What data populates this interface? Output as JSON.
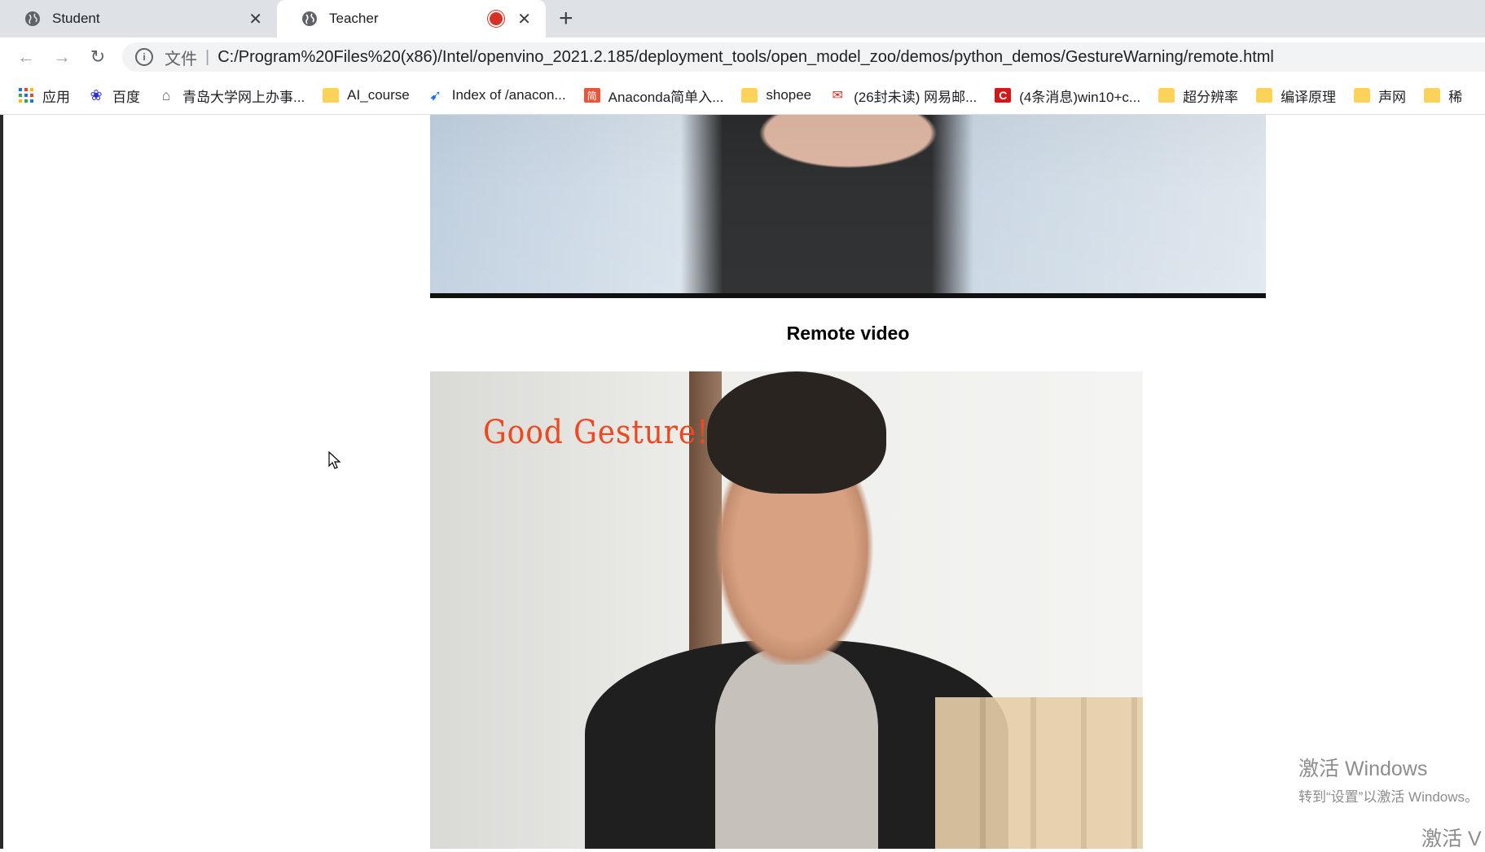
{
  "tabs": [
    {
      "label": "Student",
      "state": "inactive"
    },
    {
      "label": "Teacher",
      "state": "active",
      "recording": true
    }
  ],
  "address": {
    "scheme_label": "文件",
    "separator": "|",
    "url": "C:/Program%20Files%20(x86)/Intel/openvino_2021.2.185/deployment_tools/open_model_zoo/demos/python_demos/GestureWarning/remote.html"
  },
  "bookmarks": [
    {
      "label": "应用",
      "icon": "apps-grid-icon"
    },
    {
      "label": "百度",
      "icon": "baidu-paw-icon"
    },
    {
      "label": "青岛大学网上办事...",
      "icon": "home-icon"
    },
    {
      "label": "AI_course",
      "icon": "folder-icon"
    },
    {
      "label": "Index of /anacon...",
      "icon": "bird-icon"
    },
    {
      "label": "Anaconda简单入...",
      "icon": "jian-icon",
      "icon_text": "简"
    },
    {
      "label": "shopee",
      "icon": "folder-icon"
    },
    {
      "label": "(26封未读) 网易邮...",
      "icon": "mail-icon"
    },
    {
      "label": "(4条消息)win10+c...",
      "icon": "csdn-icon",
      "icon_text": "C"
    },
    {
      "label": "超分辨率",
      "icon": "folder-icon"
    },
    {
      "label": "编译原理",
      "icon": "folder-icon"
    },
    {
      "label": "声网",
      "icon": "folder-icon"
    },
    {
      "label": "稀",
      "icon": "folder-icon"
    }
  ],
  "page": {
    "remote_caption": "Remote video",
    "overlay_text": "Good Gesture!"
  },
  "watermark": {
    "line1": "激活 Windows",
    "line2": "转到“设置”以激活 Windows。",
    "line3": "激活 V"
  },
  "colors": {
    "overlay_text": "#f0471e",
    "recording_dot": "#d93025"
  }
}
